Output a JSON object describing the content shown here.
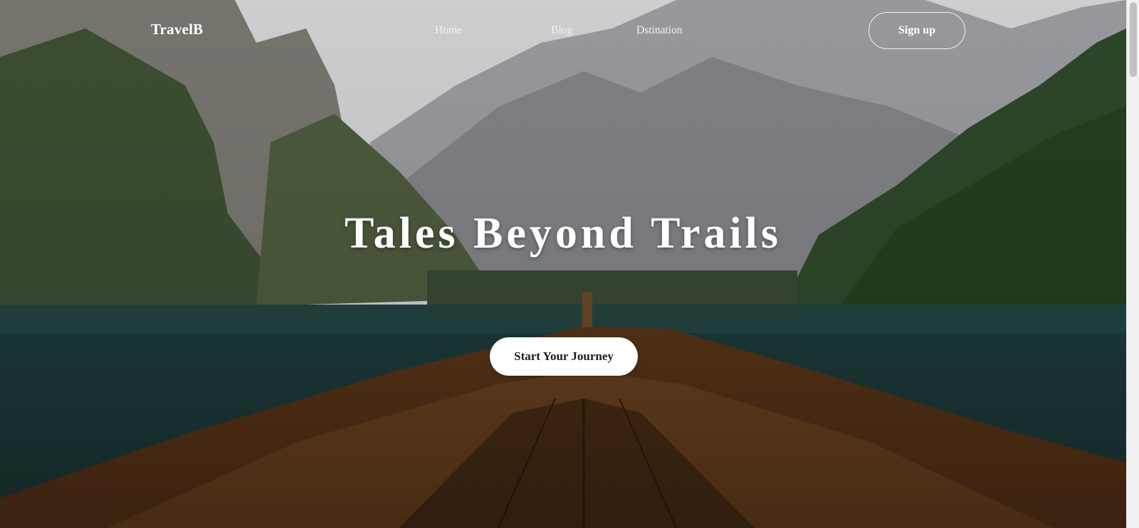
{
  "nav": {
    "brand": "TravelB",
    "links": [
      "Home",
      "Blog",
      "Dstination"
    ],
    "signup_label": "Sign up"
  },
  "hero": {
    "title": "Tales Beyond Trails",
    "cta_label": "Start Your Journey"
  },
  "colors": {
    "accent": "#ffffff",
    "cta_text": "#1e1e1e",
    "water": "#17302f",
    "forest": "#2f4a2b",
    "boat": "#5a3518"
  }
}
